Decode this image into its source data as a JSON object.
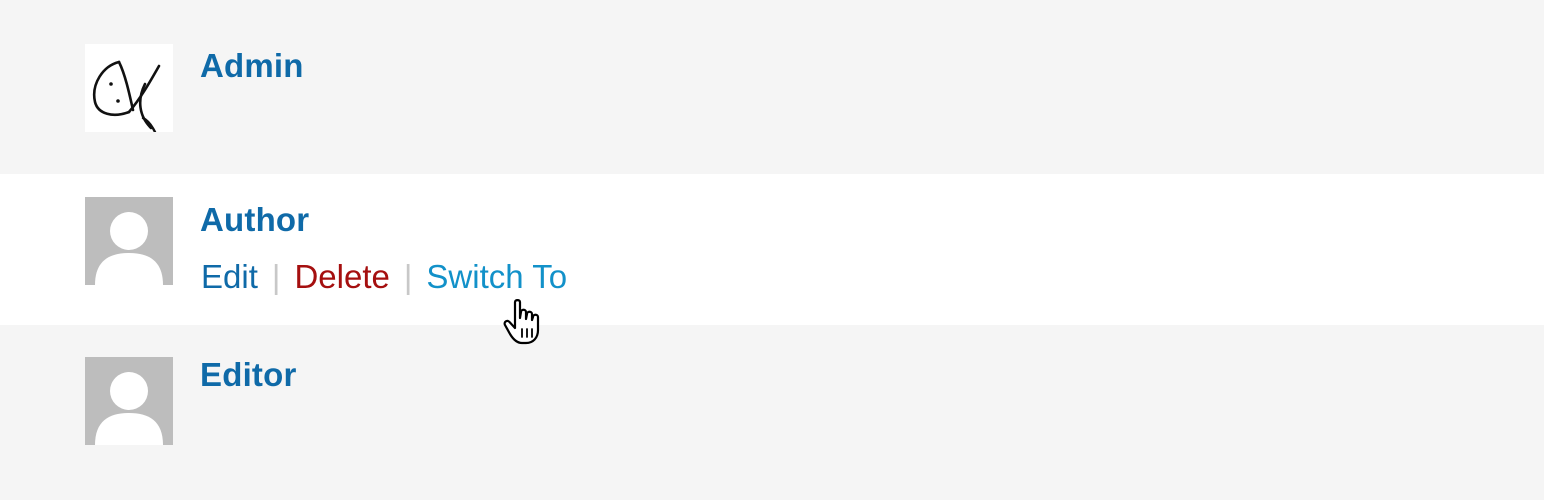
{
  "users": [
    {
      "name": "Admin",
      "avatar": "custom-sketch-avatar"
    },
    {
      "name": "Author",
      "avatar": "default-avatar",
      "actions": {
        "edit": "Edit",
        "delete": "Delete",
        "switch_to": "Switch To",
        "separator": "|"
      }
    },
    {
      "name": "Editor",
      "avatar": "default-avatar"
    }
  ],
  "icons": {
    "cursor": "hand-pointer-cursor-icon"
  },
  "colors": {
    "link": "#0f6aa8",
    "delete": "#a50f0f",
    "switch": "#1291c9",
    "row_alt": "#f5f5f5",
    "row_hover": "#ffffff",
    "avatar_placeholder": "#bdbdbd"
  }
}
